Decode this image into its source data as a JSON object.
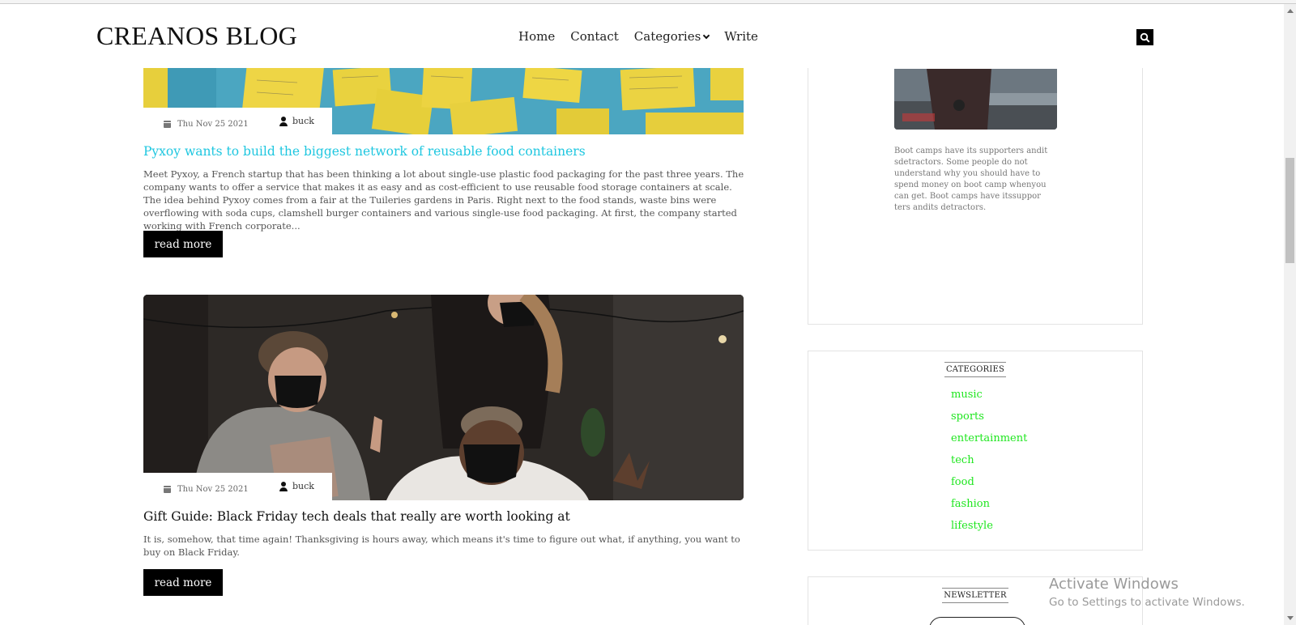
{
  "header": {
    "logo": "CREANOS BLOG",
    "nav": [
      "Home",
      "Contact",
      "Categories",
      "Write"
    ]
  },
  "posts": [
    {
      "date": "Thu Nov 25 2021",
      "author": "buck",
      "title": "Pyxoy wants to build the biggest network of reusable food containers",
      "excerpt": "Meet Pyxoy, a French startup that has been thinking a lot about single-use plastic food packaging for the past three years. The company wants to offer a service that makes it as easy and as cost-efficient to use reusable food storage containers at scale. The idea behind Pyxoy comes from a fair at the Tuileries gardens in Paris. Right next to the food stands, waste bins were overflowing with soda cups, clamshell burger containers and various single-use food packaging. At first, the company started working with French corporate...",
      "read_more": "read more"
    },
    {
      "date": "Thu Nov 25 2021",
      "author": "buck",
      "title": "Gift Guide: Black Friday tech deals that really are worth looking at",
      "excerpt": "It is, somehow, that time again! Thanksgiving is hours away, which means it's time to figure out what, if anything, you want to buy on Black Friday.",
      "read_more": "read more"
    }
  ],
  "sidebar": {
    "about_text": "Boot camps have its supporters andit sdetractors. Some people do not understand why you should have to spend money on boot camp whenyou can get. Boot camps have itssuppor ters andits detractors.",
    "categories_title": "CATEGORIES",
    "categories": [
      "music",
      "sports",
      "entertainment",
      "tech",
      "food",
      "fashion",
      "lifestyle"
    ],
    "newsletter_title": "NEWSLETTER"
  },
  "watermark": {
    "line1": "Activate Windows",
    "line2": "Go to Settings to activate Windows."
  }
}
